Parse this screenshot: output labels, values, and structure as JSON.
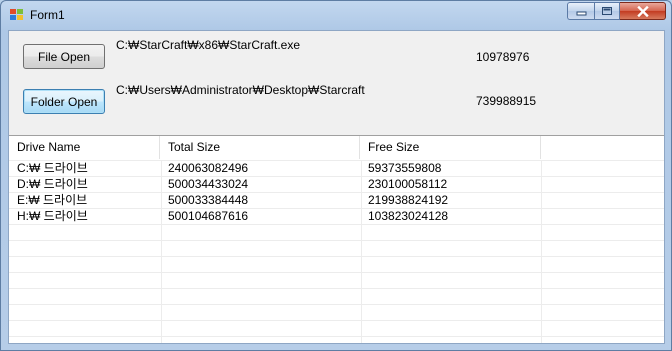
{
  "window": {
    "title": "Form1"
  },
  "file_open": {
    "button_label": "File Open",
    "path": "C:₩StarCraft₩x86₩StarCraft.exe",
    "size": "10978976"
  },
  "folder_open": {
    "button_label": "Folder Open",
    "path": "C:₩Users₩Administrator₩Desktop₩Starcraft",
    "size": "739988915"
  },
  "drive_list": {
    "columns": [
      "Drive Name",
      "Total Size",
      "Free Size",
      ""
    ],
    "rows": [
      [
        "C:₩ 드라이브",
        "240063082496",
        "59373559808"
      ],
      [
        "D:₩ 드라이브",
        "500034433024",
        "230100058112"
      ],
      [
        "E:₩ 드라이브",
        "500033384448",
        "219938824192"
      ],
      [
        "H:₩ 드라이브",
        "500104687616",
        "103823024128"
      ]
    ]
  },
  "icons": {
    "app": "windows-form-icon",
    "minimize": "minimize-icon",
    "maximize": "maximize-icon",
    "close": "close-icon"
  }
}
